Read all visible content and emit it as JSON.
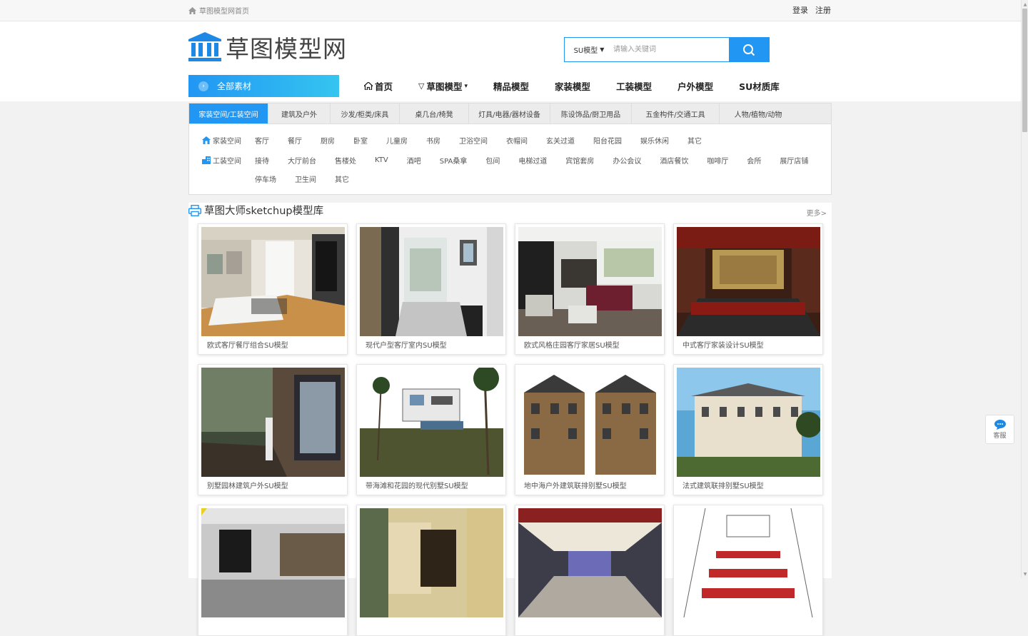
{
  "topbar": {
    "home": "草图模型网首页",
    "login": "登录",
    "register": "注册"
  },
  "logo": {
    "text": "草图模型网"
  },
  "search": {
    "select": "SU模型",
    "placeholder": "请输入关键词"
  },
  "allcat": "全部素材",
  "nav": [
    "首页",
    "草图模型",
    "精品模型",
    "家装模型",
    "工装模型",
    "户外模型",
    "SU材质库"
  ],
  "tabs": [
    "家装空间/工装空间",
    "建筑及户外",
    "沙发/柜类/床具",
    "桌几台/椅凳",
    "灯具/电器/器材设备",
    "陈设饰品/厨卫用品",
    "五金构件/交通工具",
    "人物/植物/动物"
  ],
  "home_row": {
    "head": "家装空间",
    "items": [
      "客厅",
      "餐厅",
      "厨房",
      "卧室",
      "儿童房",
      "书房",
      "卫浴空间",
      "衣帽间",
      "玄关过道",
      "阳台花园",
      "娱乐休闲",
      "其它"
    ]
  },
  "work_row": {
    "head": "工装空间",
    "items": [
      "接待",
      "大厅前台",
      "售楼处",
      "KTV",
      "酒吧",
      "SPA桑拿",
      "包间",
      "电梯过道",
      "宾馆套房",
      "办公会议",
      "酒店餐饮",
      "咖啡厅",
      "会所",
      "展厅店铺"
    ]
  },
  "work_row2": {
    "items": [
      "停车场",
      "卫生间",
      "其它"
    ]
  },
  "section": {
    "title": "草图大师sketchup模型库",
    "more": "更多>"
  },
  "cards": [
    "欧式客厅餐厅组合SU模型",
    "现代户型客厅室内SU模型",
    "欧式风格庄园客厅家居SU模型",
    "中式客厅家装设计SU模型",
    "别墅园林建筑户外SU模型",
    "带海滩和花园的现代别墅SU模型",
    "地中海户外建筑联排别墅SU模型",
    "法式建筑联排别墅SU模型",
    "",
    "",
    "",
    ""
  ],
  "service": "客服",
  "colors": {
    "accent": "#2196f3"
  }
}
